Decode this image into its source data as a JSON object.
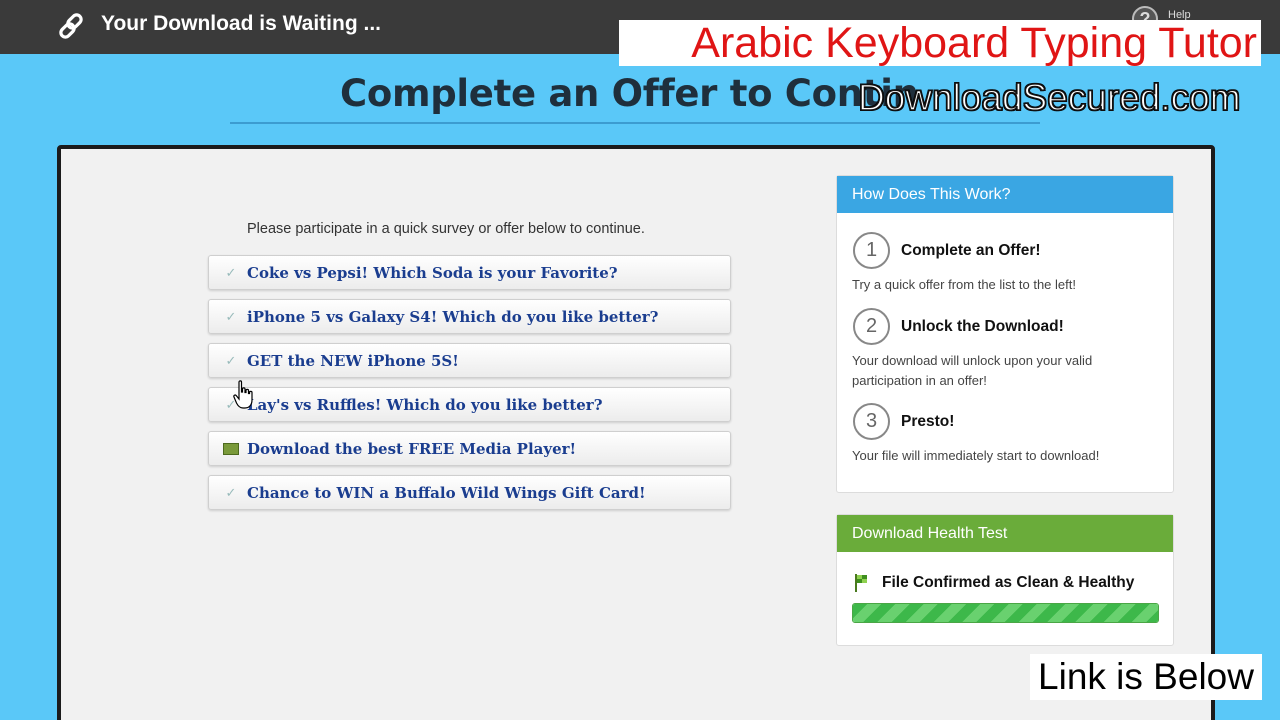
{
  "topbar": {
    "title": "Your Download is Waiting ...",
    "help_label": "Help"
  },
  "overlays": {
    "product_title": "Arabic Keyboard Typing Tutor",
    "domain": "DownloadSecured.com",
    "link_notice": "Link is Below"
  },
  "heading": "Complete an Offer to Contin",
  "instructions": "Please participate in a quick survey or offer below to continue.",
  "offers": [
    {
      "label": "Coke vs Pepsi! Which Soda is your Favorite?",
      "icon": "check-icon"
    },
    {
      "label": "iPhone 5 vs Galaxy S4! Which do you like better?",
      "icon": "check-icon"
    },
    {
      "label": "GET the NEW iPhone 5S!",
      "icon": "check-icon"
    },
    {
      "label": "Lay's vs Ruffles! Which do you like better?",
      "icon": "check-icon"
    },
    {
      "label": "Download the best FREE Media Player!",
      "icon": "media-icon"
    },
    {
      "label": "Chance to WIN a Buffalo Wild Wings Gift Card!",
      "icon": "check-icon"
    }
  ],
  "how_it_works": {
    "header": "How Does This Work?",
    "steps": [
      {
        "number": "1",
        "title": "Complete an Offer!",
        "desc": "Try a quick offer from the list to the left!"
      },
      {
        "number": "2",
        "title": "Unlock the Download!",
        "desc": "Your download will unlock upon your valid participation in an offer!"
      },
      {
        "number": "3",
        "title": "Presto!",
        "desc": "Your file will immediately start to download!"
      }
    ]
  },
  "health": {
    "header": "Download Health Test",
    "status": "File Confirmed as Clean & Healthy",
    "progress": 1.0
  },
  "colors": {
    "page_bg": "#5ac8f8",
    "topbar_bg": "#3a3a3a",
    "how_header": "#3aa6e3",
    "health_header": "#6aac3a",
    "offer_text": "#1a3d8f",
    "overlay_title": "#e01515"
  }
}
